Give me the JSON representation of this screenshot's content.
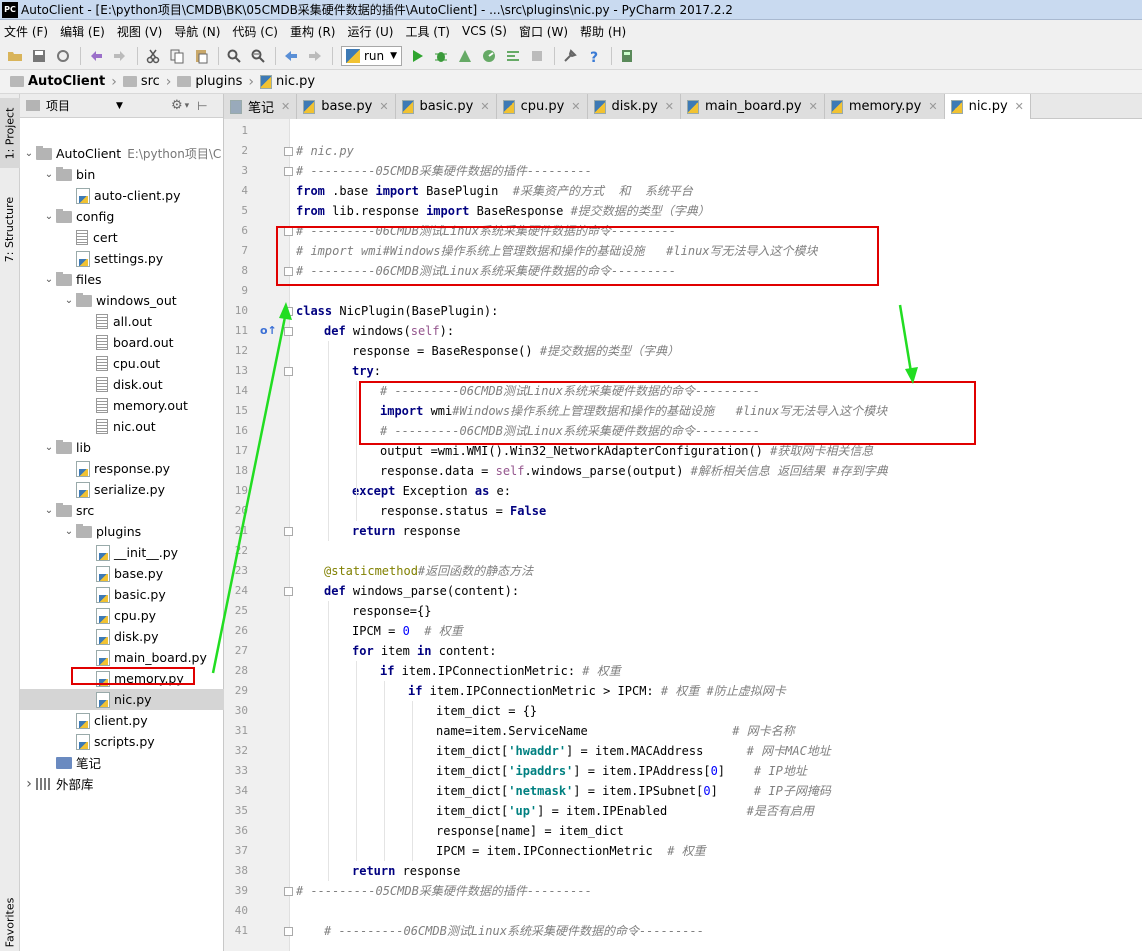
{
  "title_bar": {
    "logo": "PC",
    "text": "AutoClient - [E:\\python项目\\CMDB\\BK\\05CMDB采集硬件数据的插件\\AutoClient] - ...\\src\\plugins\\nic.py - PyCharm 2017.2.2"
  },
  "menu": [
    "文件 (F)",
    "编辑 (E)",
    "视图 (V)",
    "导航 (N)",
    "代码 (C)",
    "重构 (R)",
    "运行 (U)",
    "工具 (T)",
    "VCS (S)",
    "窗口 (W)",
    "帮助 (H)"
  ],
  "toolbar": {
    "run_config": "run"
  },
  "breadcrumb": [
    "AutoClient",
    "src",
    "plugins",
    "nic.py"
  ],
  "left_tool_tabs": [
    "1: Project",
    "7: Structure",
    "Favorites"
  ],
  "project_panel": {
    "header": "项目"
  },
  "tree": [
    {
      "label": "AutoClient",
      "hint": "E:\\python项目\\C",
      "icon": "folder",
      "depth": 0,
      "arrow": "down"
    },
    {
      "label": "bin",
      "icon": "folder",
      "depth": 1,
      "arrow": "down"
    },
    {
      "label": "auto-client.py",
      "icon": "py",
      "depth": 2
    },
    {
      "label": "config",
      "icon": "folder",
      "depth": 1,
      "arrow": "down"
    },
    {
      "label": "cert",
      "icon": "txt",
      "depth": 2
    },
    {
      "label": "settings.py",
      "icon": "py",
      "depth": 2
    },
    {
      "label": "files",
      "icon": "folder",
      "depth": 1,
      "arrow": "down"
    },
    {
      "label": "windows_out",
      "icon": "folder",
      "depth": 2,
      "arrow": "down"
    },
    {
      "label": "all.out",
      "icon": "txt",
      "depth": 3
    },
    {
      "label": "board.out",
      "icon": "txt",
      "depth": 3
    },
    {
      "label": "cpu.out",
      "icon": "txt",
      "depth": 3
    },
    {
      "label": "disk.out",
      "icon": "txt",
      "depth": 3
    },
    {
      "label": "memory.out",
      "icon": "txt",
      "depth": 3
    },
    {
      "label": "nic.out",
      "icon": "txt",
      "depth": 3
    },
    {
      "label": "lib",
      "icon": "folder",
      "depth": 1,
      "arrow": "down"
    },
    {
      "label": "response.py",
      "icon": "py",
      "depth": 2
    },
    {
      "label": "serialize.py",
      "icon": "py",
      "depth": 2
    },
    {
      "label": "src",
      "icon": "folder",
      "depth": 1,
      "arrow": "down"
    },
    {
      "label": "plugins",
      "icon": "folder",
      "depth": 2,
      "arrow": "down"
    },
    {
      "label": "__init__.py",
      "icon": "py",
      "depth": 3
    },
    {
      "label": "base.py",
      "icon": "py",
      "depth": 3
    },
    {
      "label": "basic.py",
      "icon": "py",
      "depth": 3
    },
    {
      "label": "cpu.py",
      "icon": "py",
      "depth": 3
    },
    {
      "label": "disk.py",
      "icon": "py",
      "depth": 3
    },
    {
      "label": "main_board.py",
      "icon": "py",
      "depth": 3
    },
    {
      "label": "memory.py",
      "icon": "py",
      "depth": 3
    },
    {
      "label": "nic.py",
      "icon": "py",
      "depth": 3,
      "selected": true
    },
    {
      "label": "client.py",
      "icon": "py",
      "depth": 2
    },
    {
      "label": "scripts.py",
      "icon": "py",
      "depth": 2
    },
    {
      "label": "笔记",
      "icon": "module",
      "depth": 1
    },
    {
      "label": "外部库",
      "icon": "lib",
      "depth": 0,
      "arrow": "right"
    }
  ],
  "tabs": [
    {
      "label": "笔记",
      "icon": "note"
    },
    {
      "label": "base.py",
      "icon": "py"
    },
    {
      "label": "basic.py",
      "icon": "py"
    },
    {
      "label": "cpu.py",
      "icon": "py"
    },
    {
      "label": "disk.py",
      "icon": "py"
    },
    {
      "label": "main_board.py",
      "icon": "py"
    },
    {
      "label": "memory.py",
      "icon": "py"
    },
    {
      "label": "nic.py",
      "icon": "py",
      "active": true
    }
  ],
  "code_lines": [
    {
      "n": "1",
      "indent": 0,
      "parts": []
    },
    {
      "n": "2",
      "indent": 0,
      "parts": [
        [
          "cm",
          "# nic.py"
        ]
      ]
    },
    {
      "n": "3",
      "indent": 0,
      "parts": [
        [
          "cm",
          "# ---------05CMDB采集硬件数据的插件---------"
        ]
      ]
    },
    {
      "n": "4",
      "indent": 0,
      "parts": [
        [
          "kw",
          "from"
        ],
        [
          "",
          " .base "
        ],
        [
          "kw",
          "import"
        ],
        [
          "",
          " BasePlugin  "
        ],
        [
          "cm",
          "#采集资产的方式  和  系统平台"
        ]
      ]
    },
    {
      "n": "5",
      "indent": 0,
      "parts": [
        [
          "kw",
          "from"
        ],
        [
          "",
          " lib.response "
        ],
        [
          "kw",
          "import"
        ],
        [
          "",
          " BaseResponse "
        ],
        [
          "cm",
          "#提交数据的类型（字典）"
        ]
      ]
    },
    {
      "n": "6",
      "indent": 0,
      "parts": [
        [
          "cm",
          "# ---------06CMDB测试Linux系统采集硬件数据的命令---------"
        ]
      ]
    },
    {
      "n": "7",
      "indent": 0,
      "parts": [
        [
          "cm",
          "# import wmi#Windows操作系统上管理数据和操作的基础设施   #linux写无法导入这个模块"
        ]
      ]
    },
    {
      "n": "8",
      "indent": 0,
      "parts": [
        [
          "cm",
          "# ---------06CMDB测试Linux系统采集硬件数据的命令---------"
        ]
      ]
    },
    {
      "n": "9",
      "indent": 0,
      "parts": []
    },
    {
      "n": "10",
      "indent": 0,
      "parts": [
        [
          "kw",
          "class"
        ],
        [
          "",
          " NicPlugin(BasePlugin):"
        ]
      ]
    },
    {
      "n": "11",
      "indent": 1,
      "parts": [
        [
          "kw",
          "def"
        ],
        [
          "",
          " windows("
        ],
        [
          "self",
          "self"
        ],
        [
          "",
          "):"
        ]
      ]
    },
    {
      "n": "12",
      "indent": 2,
      "parts": [
        [
          "",
          "response = BaseResponse() "
        ],
        [
          "cm",
          "#提交数据的类型（字典）"
        ]
      ]
    },
    {
      "n": "13",
      "indent": 2,
      "parts": [
        [
          "kw",
          "try"
        ],
        [
          "",
          ":"
        ]
      ]
    },
    {
      "n": "14",
      "indent": 3,
      "parts": [
        [
          "cm",
          "# ---------06CMDB测试Linux系统采集硬件数据的命令---------"
        ]
      ]
    },
    {
      "n": "15",
      "indent": 3,
      "parts": [
        [
          "kw",
          "import"
        ],
        [
          "",
          " wmi"
        ],
        [
          "cm",
          "#Windows操作系统上管理数据和操作的基础设施   #linux写无法导入这个模块"
        ]
      ]
    },
    {
      "n": "16",
      "indent": 3,
      "parts": [
        [
          "cm",
          "# ---------06CMDB测试Linux系统采集硬件数据的命令---------"
        ]
      ]
    },
    {
      "n": "17",
      "indent": 3,
      "parts": [
        [
          "",
          "output =wmi.WMI().Win32_NetworkAdapterConfiguration() "
        ],
        [
          "cm",
          "#获取网卡相关信息"
        ]
      ]
    },
    {
      "n": "18",
      "indent": 3,
      "parts": [
        [
          "",
          "response.data = "
        ],
        [
          "self",
          "self"
        ],
        [
          "",
          ".windows_parse(output) "
        ],
        [
          "cm",
          "#解析相关信息 返回结果 #存到字典"
        ]
      ]
    },
    {
      "n": "19",
      "indent": 2,
      "parts": [
        [
          "kw",
          "except"
        ],
        [
          "",
          " Exception "
        ],
        [
          "kw",
          "as"
        ],
        [
          "",
          " e:"
        ]
      ]
    },
    {
      "n": "20",
      "indent": 3,
      "parts": [
        [
          "",
          "response.status = "
        ],
        [
          "kw",
          "False"
        ]
      ]
    },
    {
      "n": "21",
      "indent": 2,
      "parts": [
        [
          "kw",
          "return"
        ],
        [
          "",
          " response"
        ]
      ]
    },
    {
      "n": "22",
      "indent": 0,
      "parts": []
    },
    {
      "n": "23",
      "indent": 1,
      "parts": [
        [
          "dec",
          "@staticmethod"
        ],
        [
          "cm",
          "#返回函数的静态方法"
        ]
      ]
    },
    {
      "n": "24",
      "indent": 1,
      "parts": [
        [
          "kw",
          "def"
        ],
        [
          "",
          " windows_parse(content):"
        ]
      ]
    },
    {
      "n": "25",
      "indent": 2,
      "parts": [
        [
          "",
          "response={}"
        ]
      ]
    },
    {
      "n": "26",
      "indent": 2,
      "parts": [
        [
          "",
          "IPCM = "
        ],
        [
          "num",
          "0"
        ],
        [
          "",
          "  "
        ],
        [
          "cm",
          "# 权重"
        ]
      ]
    },
    {
      "n": "27",
      "indent": 2,
      "parts": [
        [
          "kw",
          "for"
        ],
        [
          "",
          " item "
        ],
        [
          "kw",
          "in"
        ],
        [
          "",
          " content:"
        ]
      ]
    },
    {
      "n": "28",
      "indent": 3,
      "parts": [
        [
          "kw",
          "if"
        ],
        [
          "",
          " item.IPConnectionMetric: "
        ],
        [
          "cm",
          "# 权重"
        ]
      ]
    },
    {
      "n": "29",
      "indent": 4,
      "parts": [
        [
          "kw",
          "if"
        ],
        [
          "",
          " item.IPConnectionMetric > IPCM: "
        ],
        [
          "cm",
          "# 权重 #防止虚拟网卡"
        ]
      ]
    },
    {
      "n": "30",
      "indent": 5,
      "parts": [
        [
          "",
          "item_dict = {}"
        ]
      ]
    },
    {
      "n": "31",
      "indent": 5,
      "parts": [
        [
          "",
          "name=item.ServiceName                    "
        ],
        [
          "cm",
          "# 网卡名称"
        ]
      ]
    },
    {
      "n": "32",
      "indent": 5,
      "parts": [
        [
          "",
          "item_dict["
        ],
        [
          "str",
          "'hwaddr'"
        ],
        [
          "",
          "] = item.MACAddress      "
        ],
        [
          "cm",
          "# 网卡MAC地址"
        ]
      ]
    },
    {
      "n": "33",
      "indent": 5,
      "parts": [
        [
          "",
          "item_dict["
        ],
        [
          "str",
          "'ipaddrs'"
        ],
        [
          "",
          "] = item.IPAddress["
        ],
        [
          "num",
          "0"
        ],
        [
          "",
          "]    "
        ],
        [
          "cm",
          "# IP地址"
        ]
      ]
    },
    {
      "n": "34",
      "indent": 5,
      "parts": [
        [
          "",
          "item_dict["
        ],
        [
          "str",
          "'netmask'"
        ],
        [
          "",
          "] = item.IPSubnet["
        ],
        [
          "num",
          "0"
        ],
        [
          "",
          "]     "
        ],
        [
          "cm",
          "# IP子网掩码"
        ]
      ]
    },
    {
      "n": "35",
      "indent": 5,
      "parts": [
        [
          "",
          "item_dict["
        ],
        [
          "str",
          "'up'"
        ],
        [
          "",
          "] = item.IPEnabled           "
        ],
        [
          "cm",
          "#是否有启用"
        ]
      ]
    },
    {
      "n": "36",
      "indent": 5,
      "parts": [
        [
          "",
          "response[name] = item_dict"
        ]
      ]
    },
    {
      "n": "37",
      "indent": 5,
      "parts": [
        [
          "",
          "IPCM = item.IPConnectionMetric  "
        ],
        [
          "cm",
          "# 权重"
        ]
      ]
    },
    {
      "n": "38",
      "indent": 2,
      "parts": [
        [
          "kw",
          "return"
        ],
        [
          "",
          " response"
        ]
      ]
    },
    {
      "n": "39",
      "indent": 0,
      "parts": [
        [
          "cm",
          "# ---------05CMDB采集硬件数据的插件---------"
        ]
      ]
    },
    {
      "n": "40",
      "indent": 0,
      "parts": []
    },
    {
      "n": "41",
      "indent": 1,
      "parts": [
        [
          "cm",
          "# ---------06CMDB测试Linux系统采集硬件数据的命令---------"
        ]
      ]
    }
  ],
  "annotation_colors": {
    "box": "#e00000",
    "arrow": "#22dd22"
  }
}
